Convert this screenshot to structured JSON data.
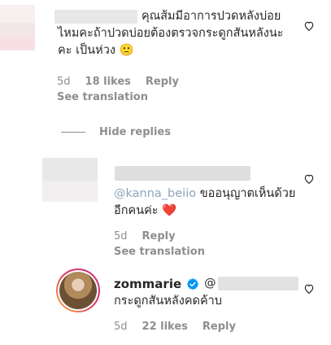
{
  "comment1": {
    "text": "คุณส้มมีอาการปวดหลังบ่อยไหมคะถ้าปวดบ่อยต้องตรวจกระดูกสันหลังนะคะ เป็นห่วง",
    "emoji": "🙁",
    "time": "5d",
    "likes": "18 likes",
    "reply": "Reply",
    "see_translation": "See translation"
  },
  "hide_replies": "Hide replies",
  "reply1": {
    "mention": "@kanna_beiio",
    "text": "ขออนุญาตเห็นด้วยอีกคนค่ะ",
    "emoji": "❤️",
    "time": "5d",
    "reply": "Reply",
    "see_translation": "See translation"
  },
  "reply2": {
    "username": "zommarie",
    "mention": "@",
    "text": "กระดูกสันหลังคดค้าบ",
    "time": "5d",
    "likes": "22 likes",
    "reply": "Reply"
  },
  "icons": {
    "like": "heart-icon",
    "verified": "verified-badge-icon"
  },
  "colors": {
    "text": "#262626",
    "muted": "#8e8e8e",
    "verified": "#0095f6",
    "heart": "#e0144c"
  }
}
